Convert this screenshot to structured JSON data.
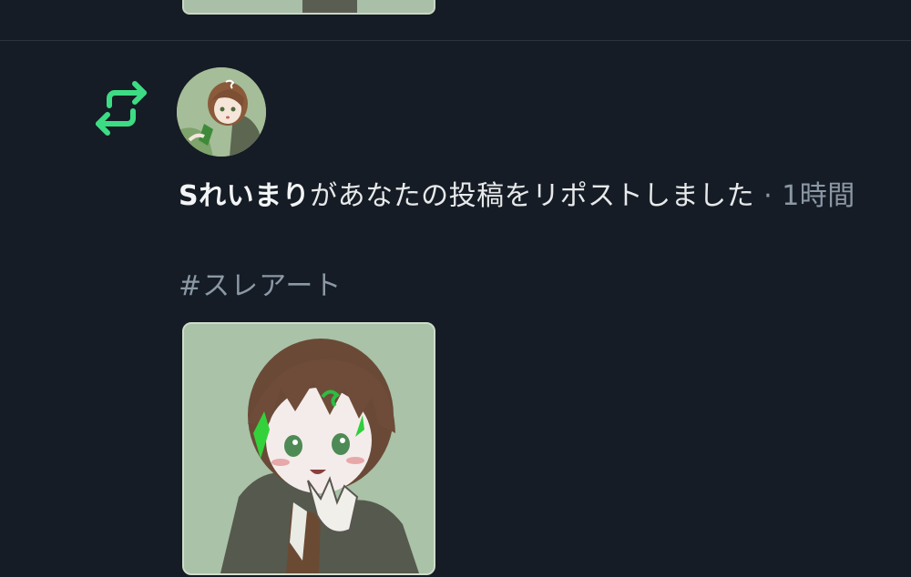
{
  "notification": {
    "type": "repost",
    "icon": "repost-icon",
    "accent_color": "#3ddc84",
    "user_name": "Sれいまり",
    "action_text": "があなたの投稿をリポストしました",
    "separator": " · ",
    "time": "1時間",
    "post": {
      "text": "#スレアート",
      "media_alt_icon": "illustration-image"
    }
  }
}
